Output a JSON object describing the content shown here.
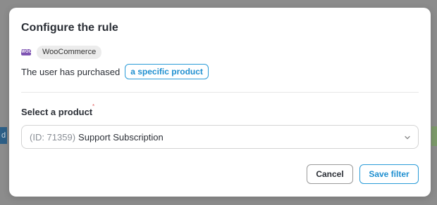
{
  "background": {
    "chip_text": "d",
    "footer_text": "..."
  },
  "modal": {
    "title": "Configure the rule",
    "integration": {
      "icon": "woocommerce-icon",
      "icon_text": "WOO",
      "name": "WooCommerce"
    },
    "rule": {
      "text": "The user has purchased",
      "pill_label": "a specific product"
    },
    "field": {
      "label": "Select a product",
      "required_mark": "*",
      "value_prefix": "(ID: 71359)",
      "value": "Support Subscription"
    },
    "buttons": {
      "cancel": "Cancel",
      "save": "Save filter"
    },
    "colors": {
      "accent": "#2a9bd8",
      "woo_purple": "#7f54b3"
    }
  }
}
